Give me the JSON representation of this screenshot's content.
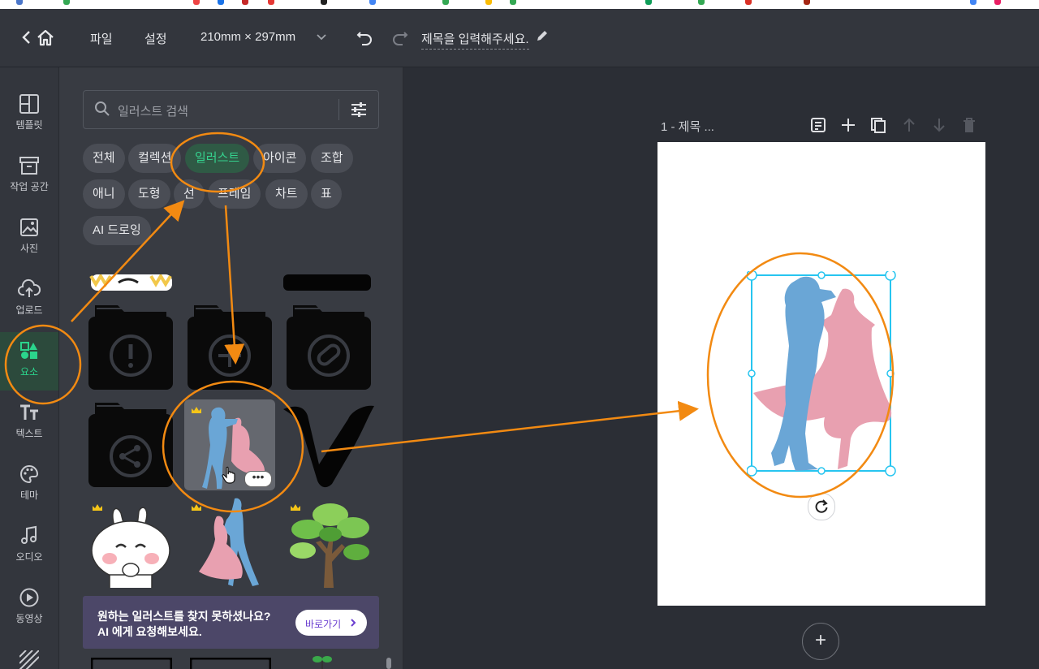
{
  "header": {
    "back_label": "<",
    "home_icon": "home-icon",
    "menu_file": "파일",
    "menu_settings": "설정",
    "page_size": "210mm × 297mm",
    "title_placeholder": "제목을 입력해주세요."
  },
  "rail": {
    "items": [
      {
        "label": "템플릿",
        "icon": "layout-icon"
      },
      {
        "label": "작업 공간",
        "icon": "archive-icon"
      },
      {
        "label": "사진",
        "icon": "image-icon"
      },
      {
        "label": "업로드",
        "icon": "upload-icon"
      },
      {
        "label": "요소",
        "icon": "shapes-icon",
        "active": true
      },
      {
        "label": "텍스트",
        "icon": "text-icon"
      },
      {
        "label": "테마",
        "icon": "palette-icon"
      },
      {
        "label": "오디오",
        "icon": "music-icon"
      },
      {
        "label": "동영상",
        "icon": "play-icon"
      }
    ]
  },
  "panel": {
    "search_placeholder": "일러스트 검색",
    "categories": [
      {
        "label": "전체"
      },
      {
        "label": "컬렉션"
      },
      {
        "label": "일러스트",
        "active": true
      },
      {
        "label": "아이콘"
      },
      {
        "label": "조합"
      },
      {
        "label": "애니"
      },
      {
        "label": "도형"
      },
      {
        "label": "선"
      },
      {
        "label": "프레임"
      },
      {
        "label": "차트"
      },
      {
        "label": "표"
      },
      {
        "label": "AI 드로잉"
      }
    ],
    "ai_banner": {
      "line1": "원하는 일러스트를 찾지 못하셨나요?",
      "line2": "AI 에게 요청해보세요.",
      "button": "바로가기"
    }
  },
  "canvas": {
    "page_label": "1 - 제목 ...",
    "add_page": "+"
  },
  "colors": {
    "accent": "#2bd48c",
    "annotation": "#f28a12",
    "selection": "#27c5f0",
    "dancer_blue": "#6aa6d6",
    "dancer_pink": "#e8a0b0"
  }
}
